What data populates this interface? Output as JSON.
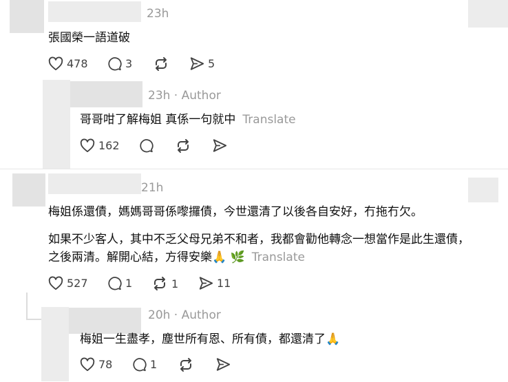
{
  "comments": [
    {
      "time": "23h",
      "lines": [
        "張國榮一語道破"
      ],
      "likes": "478",
      "replies": "3",
      "reposts": "",
      "shares": "5"
    },
    {
      "time": "23h · Author",
      "lines": [
        "哥哥咁了解梅姐 真係一句就中"
      ],
      "translate": "Translate",
      "likes": "162",
      "replies": "",
      "reposts": "",
      "shares": ""
    },
    {
      "time": "21h",
      "lines": [
        "梅姐係還債，媽媽哥哥係嚟攞債，今世還清了以後各自安好，冇拖冇欠。",
        "如果不少客人，其中不乏父母兄弟不和者，我都會勸他轉念一想當作是此生還債，",
        "之後兩清。解開心結，方得安樂",
        "🙏",
        "🌿"
      ],
      "translate": "Translate",
      "likes": "527",
      "replies": "1",
      "reposts": "1",
      "shares": "11"
    },
    {
      "time": "20h · Author",
      "lines": [
        "梅姐一生盡孝，塵世所有恩、所有債，都還清了",
        "🙏"
      ],
      "likes": "78",
      "replies": "1",
      "reposts": "",
      "shares": ""
    }
  ],
  "colors": {
    "text": "#101010",
    "muted": "#999999",
    "icon": "#424242",
    "avatar_blur": "#e3e3e3"
  },
  "icons": [
    "heart-icon",
    "comment-icon",
    "repost-icon",
    "share-icon"
  ]
}
